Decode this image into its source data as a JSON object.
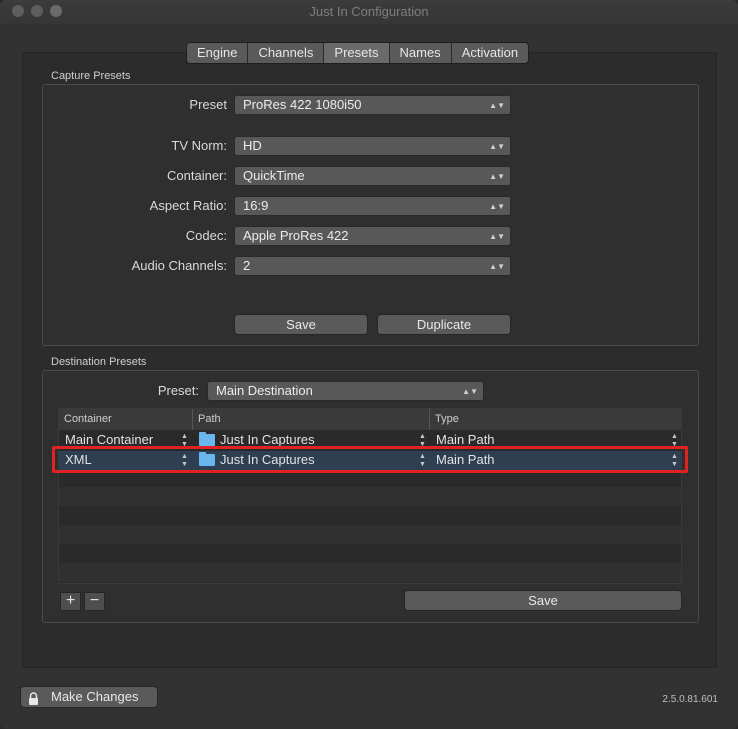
{
  "window": {
    "title": "Just In Configuration"
  },
  "tabs": [
    "Engine",
    "Channels",
    "Presets",
    "Names",
    "Activation"
  ],
  "capture": {
    "group_label": "Capture Presets",
    "preset_label": "Preset",
    "preset_value": "ProRes 422 1080i50",
    "fields": [
      {
        "label": "TV Norm:",
        "value": "HD"
      },
      {
        "label": "Container:",
        "value": "QuickTime"
      },
      {
        "label": "Aspect Ratio:",
        "value": "16:9"
      },
      {
        "label": "Codec:",
        "value": "Apple ProRes 422"
      },
      {
        "label": "Audio Channels:",
        "value": "2"
      }
    ],
    "save_label": "Save",
    "duplicate_label": "Duplicate"
  },
  "destination": {
    "group_label": "Destination Presets",
    "preset_label": "Preset:",
    "preset_value": "Main Destination",
    "columns": [
      "Container",
      "Path",
      "Type"
    ],
    "rows": [
      {
        "container": "Main Container",
        "path": "Just In Captures",
        "type": "Main Path"
      },
      {
        "container": "XML",
        "path": "Just In Captures",
        "type": "Main Path"
      }
    ],
    "add_label": "+",
    "remove_label": "−",
    "save_label": "Save"
  },
  "footer": {
    "make_changes_label": "Make Changes",
    "version": "2.5.0.81.601"
  },
  "icons": {
    "lock": "lock-icon",
    "folder": "folder-icon",
    "stepper": "up-down-arrows"
  },
  "colors": {
    "highlight": "#e02222",
    "selected_row": "#2e3f52",
    "folder": "#68b6ec"
  }
}
